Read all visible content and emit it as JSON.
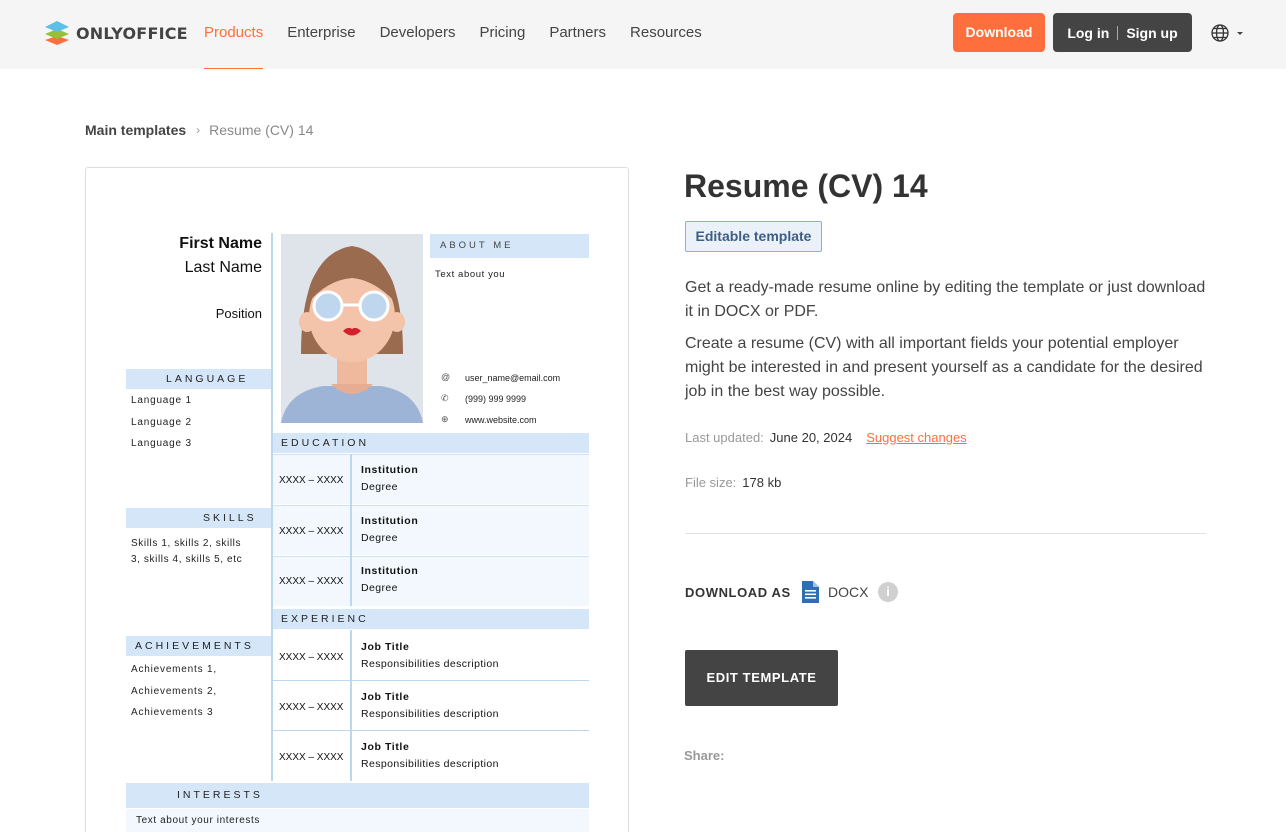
{
  "header": {
    "logo_text": "ONLYOFFICE",
    "nav": [
      "Products",
      "Enterprise",
      "Developers",
      "Pricing",
      "Partners",
      "Resources"
    ],
    "active_nav": "Products",
    "download_label": "Download",
    "login_label": "Log in",
    "signup_label": "Sign up"
  },
  "breadcrumb": {
    "main": "Main templates",
    "current": "Resume (CV) 14"
  },
  "preview": {
    "first_name": "First Name",
    "last_name": "Last Name",
    "position": "Position",
    "about_heading": "ABOUT ME",
    "about_text": "Text about you",
    "email": "user_name@email.com",
    "phone": "(999) 999 9999",
    "website": "www.website.com",
    "language_heading": "LANGUAGE",
    "languages": [
      "Language 1",
      "Language 2",
      "Language 3"
    ],
    "education_heading": "EDUCATION",
    "education": [
      {
        "dates": "XXXX – XXXX",
        "institution": "Institution",
        "degree": "Degree"
      },
      {
        "dates": "XXXX – XXXX",
        "institution": "Institution",
        "degree": "Degree"
      },
      {
        "dates": "XXXX – XXXX",
        "institution": "Institution",
        "degree": "Degree"
      }
    ],
    "skills_heading": "SKILLS",
    "skills_line1": "Skills 1, skills 2, skills",
    "skills_line2": "3, skills 4, skills 5, etc",
    "experience_heading": "EXPERIENC",
    "experience": [
      {
        "dates": "XXXX – XXXX",
        "title": "Job Title",
        "description": "Responsibilities description"
      },
      {
        "dates": "XXXX – XXXX",
        "title": "Job Title",
        "description": "Responsibilities description"
      },
      {
        "dates": "XXXX – XXXX",
        "title": "Job Title",
        "description": "Responsibilities description"
      }
    ],
    "achievements_heading": "ACHIEVEMENTS",
    "achievements": [
      "Achievements 1,",
      "Achievements 2,",
      "Achievements 3"
    ],
    "interests_heading": "INTERESTS",
    "interests_text": "Text about your interests"
  },
  "template": {
    "title": "Resume (CV) 14",
    "badge": "Editable template",
    "description_1": "Get a ready-made resume online by editing the template or just download it in DOCX or PDF.",
    "description_2": "Create a resume (CV) with all important fields your potential employer might be interested in and present yourself as a candidate for the desired job in the best way possible.",
    "last_updated_label": "Last updated:",
    "last_updated_value": "June 20, 2024",
    "suggest_label": "Suggest changes",
    "file_size_label": "File size:",
    "file_size_value": "178 kb",
    "download_as_label": "DOWNLOAD AS",
    "format": "DOCX",
    "edit_button": "EDIT TEMPLATE",
    "share_label": "Share:"
  },
  "colors": {
    "accent": "#ff6f3d",
    "dark_button": "#444444",
    "cv_band": "#d4e6f8"
  }
}
